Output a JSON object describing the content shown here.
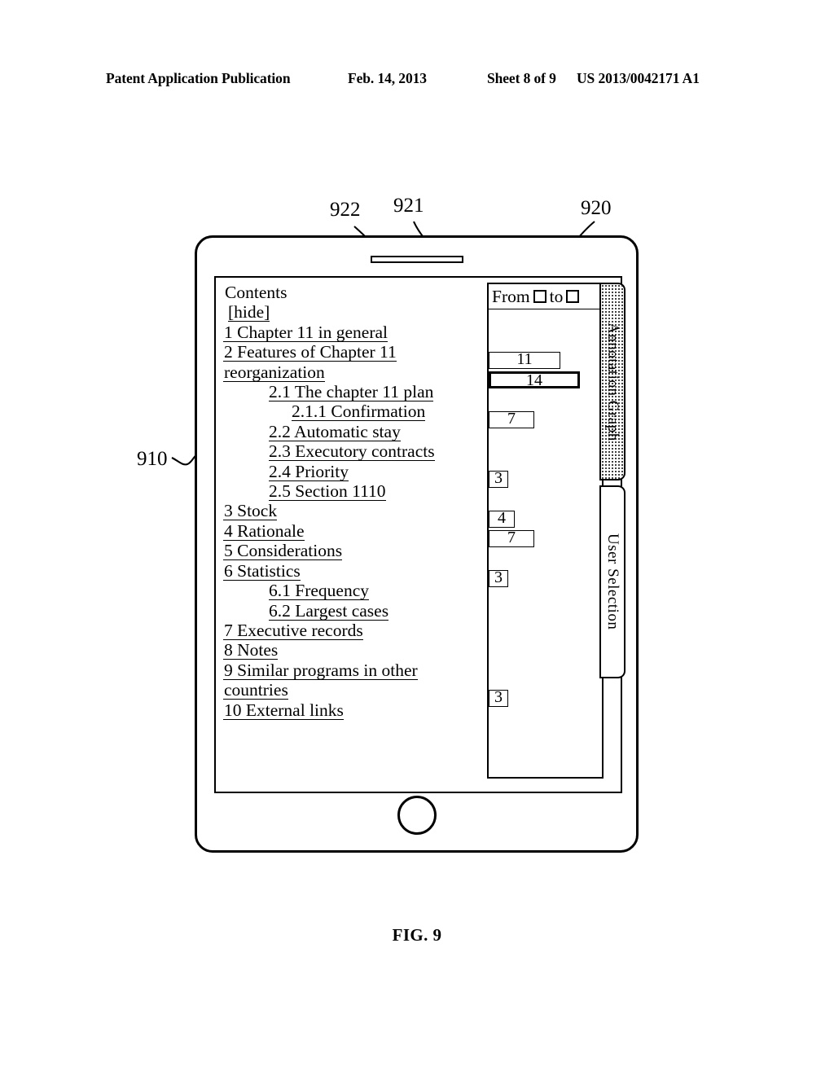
{
  "patent_header": {
    "publication": "Patent Application Publication",
    "date": "Feb. 14, 2013",
    "sheet": "Sheet 8 of 9",
    "number": "US 2013/0042171 A1"
  },
  "figure": {
    "caption": "FIG. 9",
    "reference_numerals": {
      "device": "910",
      "tab_region": "920",
      "range_selector": "921",
      "highlighted_bar": "922"
    }
  },
  "device": {
    "name": "tablet-device",
    "speaker": "speaker-slot",
    "home_button": "home-button"
  },
  "screen": {
    "contents": {
      "title": "Contents",
      "hide_label": "[hide]",
      "items": [
        {
          "label": "1 Chapter 11 in general",
          "level": 0,
          "bar": 11,
          "emphasis": false
        },
        {
          "label": "2 Features of Chapter 11",
          "level": 0,
          "bar": 14,
          "emphasis": true
        },
        {
          "label": "reorganization",
          "level": 0,
          "continuation": true
        },
        {
          "label": "2.1 The chapter 11 plan",
          "level": 1,
          "bar": 7,
          "emphasis": false
        },
        {
          "label": "2.1.1 Confirmation",
          "level": 2
        },
        {
          "label": "2.2 Automatic stay",
          "level": 1
        },
        {
          "label": "2.3 Executory contracts",
          "level": 1,
          "bar": 3,
          "emphasis": false
        },
        {
          "label": "2.4 Priority",
          "level": 1
        },
        {
          "label": "2.5 Section 1110",
          "level": 1,
          "bar": 4,
          "emphasis": false
        },
        {
          "label": "3 Stock",
          "level": 0,
          "bar": 7,
          "emphasis": false
        },
        {
          "label": "4 Rationale",
          "level": 0
        },
        {
          "label": "5 Considerations",
          "level": 0,
          "bar": 3,
          "emphasis": false
        },
        {
          "label": "6 Statistics",
          "level": 0
        },
        {
          "label": "6.1 Frequency",
          "level": 1
        },
        {
          "label": "6.2 Largest cases",
          "level": 1
        },
        {
          "label": "7 Executive records",
          "level": 0
        },
        {
          "label": "8 Notes",
          "level": 0
        },
        {
          "label": "9 Similar programs in other",
          "level": 0,
          "bar": 3,
          "emphasis": false
        },
        {
          "label": "countries",
          "level": 0,
          "continuation": true
        },
        {
          "label": "10 External links",
          "level": 0
        }
      ]
    },
    "annotation_graph": {
      "range_selector": {
        "from_label": "From",
        "to_label": "to",
        "from_value": "",
        "to_value": ""
      }
    },
    "tabs": [
      {
        "label": "Annotation Graph",
        "active": true
      },
      {
        "label": "User Selection",
        "active": false
      }
    ]
  },
  "chart_data": {
    "type": "bar",
    "title": "Annotation Graph",
    "orientation": "horizontal",
    "xlabel": "",
    "ylabel": "",
    "categories": [
      "1 Chapter 11 in general",
      "2 Features of Chapter 11 reorganization",
      "2.1 The chapter 11 plan",
      "2.3 Executory contracts",
      "2.5 Section 1110",
      "3 Stock",
      "5 Considerations",
      "9 Similar programs in other countries"
    ],
    "values": [
      11,
      14,
      7,
      3,
      4,
      7,
      3,
      3
    ],
    "value_labels": [
      "11",
      "14",
      "7",
      "3",
      "4",
      "7",
      "3",
      "3"
    ],
    "highlighted": [
      "2 Features of Chapter 11 reorganization"
    ],
    "xlim": [
      0,
      14
    ],
    "grid": false,
    "legend": null
  }
}
